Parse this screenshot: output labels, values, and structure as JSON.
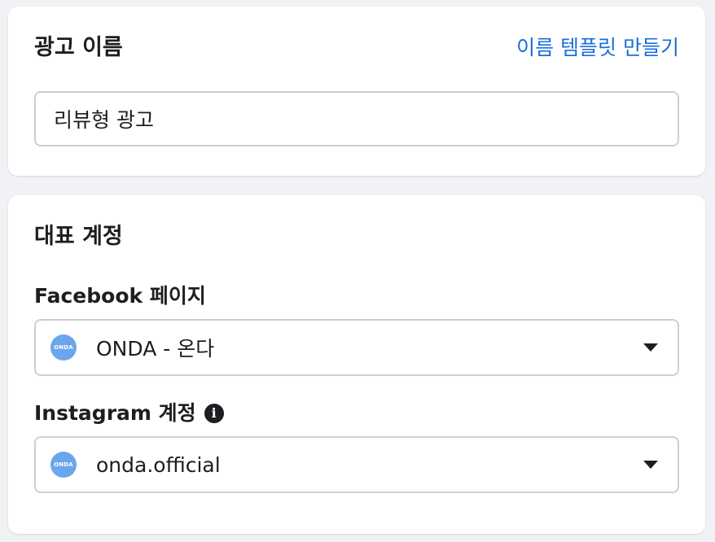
{
  "ad_name": {
    "title": "광고 이름",
    "template_link": "이름 템플릿 만들기",
    "value": "리뷰형 광고"
  },
  "identity": {
    "title": "대표 계정",
    "facebook": {
      "label": "Facebook 페이지",
      "avatar_text": "ONDA",
      "value": "ONDA - 온다"
    },
    "instagram": {
      "label": "Instagram 계정",
      "info_icon": "i",
      "avatar_text": "ONDA",
      "value": "onda.official"
    }
  },
  "colors": {
    "link": "#1a6ed8",
    "avatar": "#6aa6ee",
    "border": "#ccd0d5",
    "background": "#f0f2f5"
  }
}
